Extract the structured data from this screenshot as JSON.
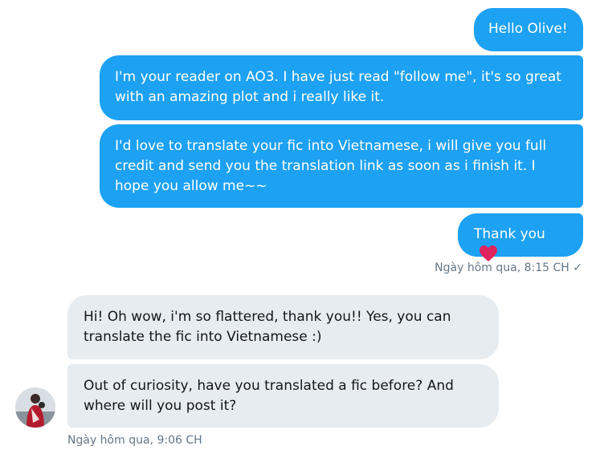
{
  "outgoing": [
    {
      "text": "Hello Olive!"
    },
    {
      "text": "I'm your reader on AO3. I have just read \"follow me\", it's so great with an amazing plot and i really like it."
    },
    {
      "text": "I'd love to translate your fic into Vietnamese, i will give you full credit and send you the translation link as soon as i finish it. I hope you allow me~~"
    },
    {
      "text": "Thank you",
      "emoji": "heart-icon"
    }
  ],
  "outgoing_meta": {
    "timestamp": "Ngày hôm qua, 8:15 CH",
    "status": "✓"
  },
  "incoming": [
    {
      "text": "Hi! Oh wow, i'm so flattered, thank you!! Yes, you can translate the fic into Vietnamese :)"
    },
    {
      "text": "Out of curiosity, have you translated a fic before? And where will you post it?"
    }
  ],
  "incoming_meta": {
    "timestamp": "Ngày hôm qua, 9:06 CH"
  },
  "colors": {
    "outgoing_bubble": "#1da1f2",
    "incoming_bubble": "#e6ecf0",
    "heart": "#e0245e"
  }
}
